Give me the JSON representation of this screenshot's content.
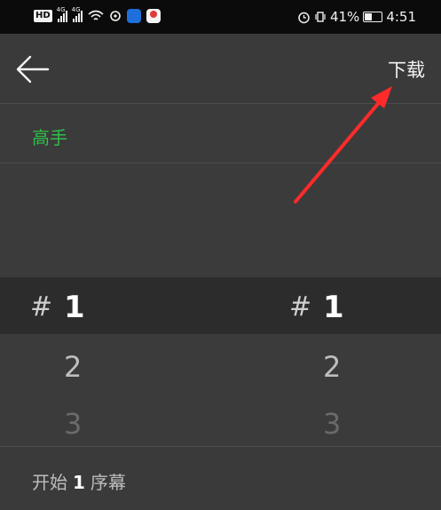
{
  "status_bar": {
    "hd": "HD",
    "net1": "4G",
    "net2": "4G",
    "battery_pct": "41%",
    "time": "4:51",
    "icons": [
      "hd-icon",
      "signal-icon",
      "signal-icon",
      "wifi-icon",
      "sync-icon",
      "shield-app-icon",
      "location-app-icon",
      "alarm-icon",
      "vibrate-icon",
      "battery-icon"
    ]
  },
  "header": {
    "back_icon": "arrow-left-icon",
    "download_label": "下载"
  },
  "level": {
    "label": "高手",
    "color": "#2fbf4a"
  },
  "picker_left": {
    "prefix": "#",
    "values": [
      "1",
      "2",
      "3"
    ]
  },
  "picker_right": {
    "prefix": "#",
    "values": [
      "1",
      "2",
      "3"
    ]
  },
  "bottom": {
    "prefix": "开始",
    "number": "1",
    "suffix": "序幕"
  },
  "annotation": {
    "type": "red-arrow",
    "color": "#ff2a2a",
    "points_to": "download-button"
  }
}
